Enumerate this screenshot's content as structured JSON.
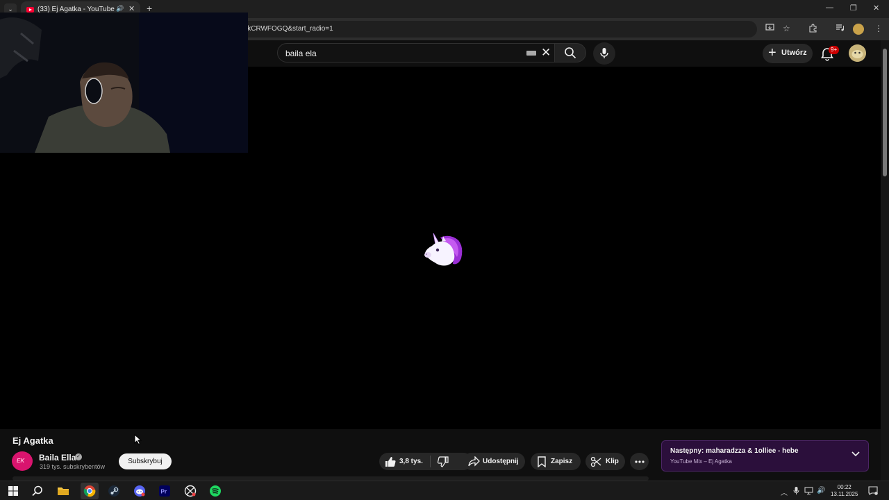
{
  "browser": {
    "tab_title": "(33) Ej Agatka - YouTube",
    "url": "lkCRWFOGQ&start_radio=1",
    "new_tab_icon": "plus-icon",
    "window_controls": [
      "minimize-icon",
      "restore-icon",
      "close-icon"
    ]
  },
  "header": {
    "search_value": "baila ela",
    "create_label": "Utwórz",
    "notifications_badge": "9+"
  },
  "video": {
    "title": "Ej Agatka",
    "channel_name": "Baila Ella",
    "channel_avatar_text": "EK",
    "subscribers": "319 tys. subskrybentów",
    "subscribe_label": "Subskrybuj",
    "likes": "3,8 tys.",
    "share_label": "Udostępnij",
    "save_label": "Zapisz",
    "clip_label": "Klip"
  },
  "up_next": {
    "title": "Następny: maharadzza & 1olliee - hebe",
    "subtitle": "YouTube Mix – Ej Agatka"
  },
  "taskbar": {
    "time": "00:22",
    "date": "13.11.2025",
    "apps": [
      "windows-start-icon",
      "search-icon",
      "file-explorer-icon",
      "chrome-icon",
      "steam-icon",
      "discord-icon",
      "premiere-icon",
      "xbox-icon",
      "spotify-icon"
    ]
  },
  "colors": {
    "background": "#0f0f0f",
    "accent_red": "#ff0033",
    "up_next_bg": "#2b0f3b",
    "spotify_green": "#1ed760"
  }
}
